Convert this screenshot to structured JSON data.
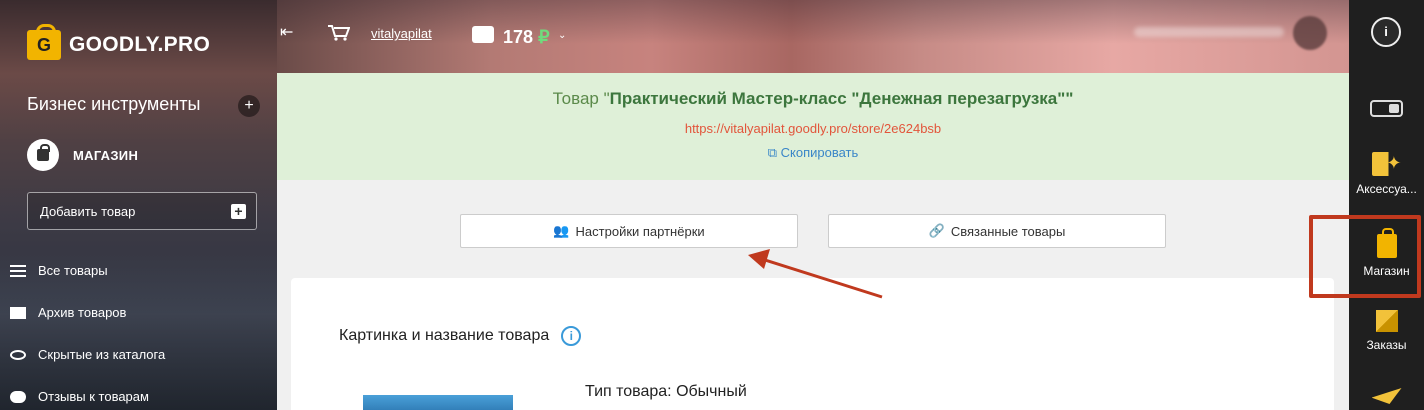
{
  "sidebar": {
    "logo_text": "GOODLY.PRO",
    "logo_letter": "G",
    "section_title": "Бизнес инструменты",
    "section_add": "+",
    "shop_label": "МАГАЗИН",
    "add_product_label": "Добавить товар",
    "menu": [
      {
        "label": "Все товары",
        "icon": "list-icon"
      },
      {
        "label": "Архив товаров",
        "icon": "archive-icon"
      },
      {
        "label": "Скрытые из каталога",
        "icon": "eye-hidden-icon"
      },
      {
        "label": "Отзывы к товарам",
        "icon": "comments-icon"
      }
    ]
  },
  "header": {
    "username": "vitalyapilat",
    "balance": "178",
    "currency": "₽",
    "caret": "⌄"
  },
  "banner": {
    "title_prefix": "Товар \"",
    "title_product": "Практический Мастер-класс \"Денежная перезагрузка\"",
    "title_suffix": "\"",
    "link": "https://vitalyapilat.goodly.pro/store/2e624bsb",
    "copy_label": "Скопировать"
  },
  "main": {
    "tab_partner": "Настройки партнёрки",
    "tab_related": "Связанные товары",
    "card_title": "Картинка и название товара",
    "product_type": "Тип товара: Обычный"
  },
  "rightbar": {
    "info": "i",
    "items": [
      {
        "label": "Аксессуа...",
        "icon": "accessories-icon"
      },
      {
        "label": "Магазин",
        "icon": "shop-bag-icon"
      },
      {
        "label": "Заказы",
        "icon": "orders-icon"
      }
    ]
  },
  "colors": {
    "banner_bg": "#dff0d8",
    "banner_title": "#3c763d",
    "link_color": "#e2553b",
    "copy_color": "#3a86c8",
    "accent_yellow": "#f2b400",
    "highlight_red": "#c0391e",
    "balance_currency": "#6fdc7d"
  }
}
